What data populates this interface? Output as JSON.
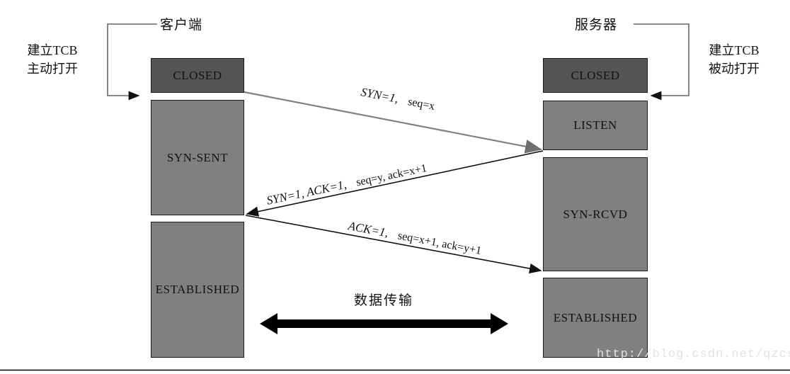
{
  "diagram": {
    "title_client": "客户端",
    "title_server": "服务器",
    "note_client": "建立TCB\n主动打开",
    "note_client_line1": "建立TCB",
    "note_client_line2": "主动打开",
    "note_server_line1": "建立TCB",
    "note_server_line2": "被动打开",
    "data_transfer_label": "数据传输",
    "watermark": "http://blog.csdn.net/qzcsu"
  },
  "client_states": [
    {
      "label": "CLOSED",
      "shade": "dark"
    },
    {
      "label": "SYN-SENT",
      "shade": "mid"
    },
    {
      "label": "ESTABLISHED",
      "shade": "mid"
    }
  ],
  "server_states": [
    {
      "label": "CLOSED",
      "shade": "dark"
    },
    {
      "label": "LISTEN",
      "shade": "mid"
    },
    {
      "label": "SYN-RCVD",
      "shade": "mid"
    },
    {
      "label": "ESTABLISHED",
      "shade": "mid"
    }
  ],
  "messages": [
    {
      "id": "syn",
      "part1": "SYN=1,",
      "part2": "seq=x",
      "direction": "client-to-server",
      "color": "#808080"
    },
    {
      "id": "syn-ack",
      "part1": "SYN=1,  ACK=1,",
      "part2": "seq=y, ack=x+1",
      "direction": "server-to-client",
      "color": "#111111"
    },
    {
      "id": "ack",
      "part1": "ACK=1,",
      "part2": "seq=x+1, ack=y+1",
      "direction": "client-to-server",
      "color": "#111111"
    }
  ],
  "colors": {
    "state_dark": "#555555",
    "state_mid": "#808080",
    "line_gray": "#808080",
    "line_black": "#111111",
    "text": "#111111",
    "watermark": "#e2e2e2"
  }
}
